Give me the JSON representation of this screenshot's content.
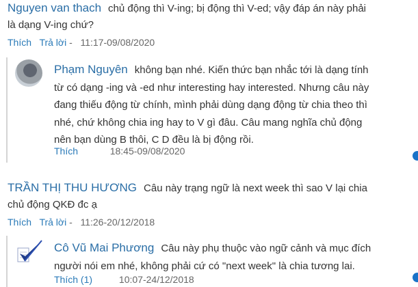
{
  "comments": [
    {
      "author": "Nguyen van thach",
      "lines": [
        "chủ động thì V-ing; bị động thì V-ed; vậy đáp án này phải",
        "là dạng V-ing chứ?"
      ],
      "like_label": "Thích",
      "reply_label": "Trả lời",
      "separator": "-",
      "timestamp": "11:17-09/08/2020",
      "reply": {
        "author": "Phạm Nguyên",
        "lines": [
          "không bạn nhé. Kiến thức bạn nhắc tới là dạng tính",
          "từ có dạng -ing và -ed như interesting hay interested. Nhưng câu này",
          "đang thiếu động từ chính, mình phải dùng dạng động từ chia theo thì",
          "nhé, chứ không chia ing hay to V gì đâu. Câu mang nghĩa chủ động",
          "nên bạn dùng B thôi, C D đều là bị động rồi."
        ],
        "like_label": "Thích",
        "timestamp": "18:45-09/08/2020"
      }
    },
    {
      "author": "TRẦN THỊ THU HƯƠNG",
      "lines": [
        "Câu này trạng ngữ là next week thì sao V lại chia",
        "chủ động QKĐ đc ạ"
      ],
      "like_label": "Thích",
      "reply_label": "Trả lời",
      "separator": "-",
      "timestamp": "11:26-20/12/2018",
      "reply": {
        "author": "Cô Vũ Mai Phương",
        "lines": [
          "Câu này phụ thuộc vào ngữ cảnh và mục đích",
          "người nói em nhé, không phải cứ có \"next week\" là chia tương lai."
        ],
        "like_label": "Thích (1)",
        "timestamp": "10:07-24/12/2018"
      }
    }
  ],
  "colors": {
    "author": "#2a6ea6",
    "link": "#2a7ab8",
    "text": "#333333",
    "accent_dot": "#1a73c8"
  }
}
